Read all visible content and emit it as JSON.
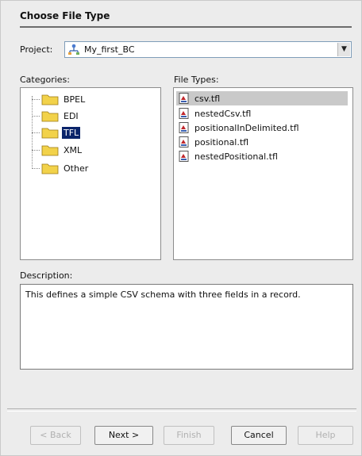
{
  "header": {
    "title": "Choose File Type"
  },
  "project": {
    "label": "Project:",
    "value": "My_first_BC",
    "icon": "project-icon"
  },
  "categories": {
    "label": "Categories:",
    "items": [
      {
        "label": "BPEL",
        "selected": false
      },
      {
        "label": "EDI",
        "selected": false
      },
      {
        "label": "TFL",
        "selected": true
      },
      {
        "label": "XML",
        "selected": false
      },
      {
        "label": "Other",
        "selected": false
      }
    ]
  },
  "file_types": {
    "label": "File Types:",
    "items": [
      {
        "label": "csv.tfl",
        "selected": true
      },
      {
        "label": "nestedCsv.tfl",
        "selected": false
      },
      {
        "label": "positionalInDelimited.tfl",
        "selected": false
      },
      {
        "label": "positional.tfl",
        "selected": false
      },
      {
        "label": "nestedPositional.tfl",
        "selected": false
      }
    ]
  },
  "description": {
    "label": "Description:",
    "text": "This defines a simple CSV schema with three fields in a record."
  },
  "buttons": {
    "back": "< Back",
    "next": "Next >",
    "finish": "Finish",
    "cancel": "Cancel",
    "help": "Help"
  },
  "colors": {
    "selection": "#0a246a",
    "folder": "#f2d24a",
    "file_selected": "#c9c9c9"
  }
}
